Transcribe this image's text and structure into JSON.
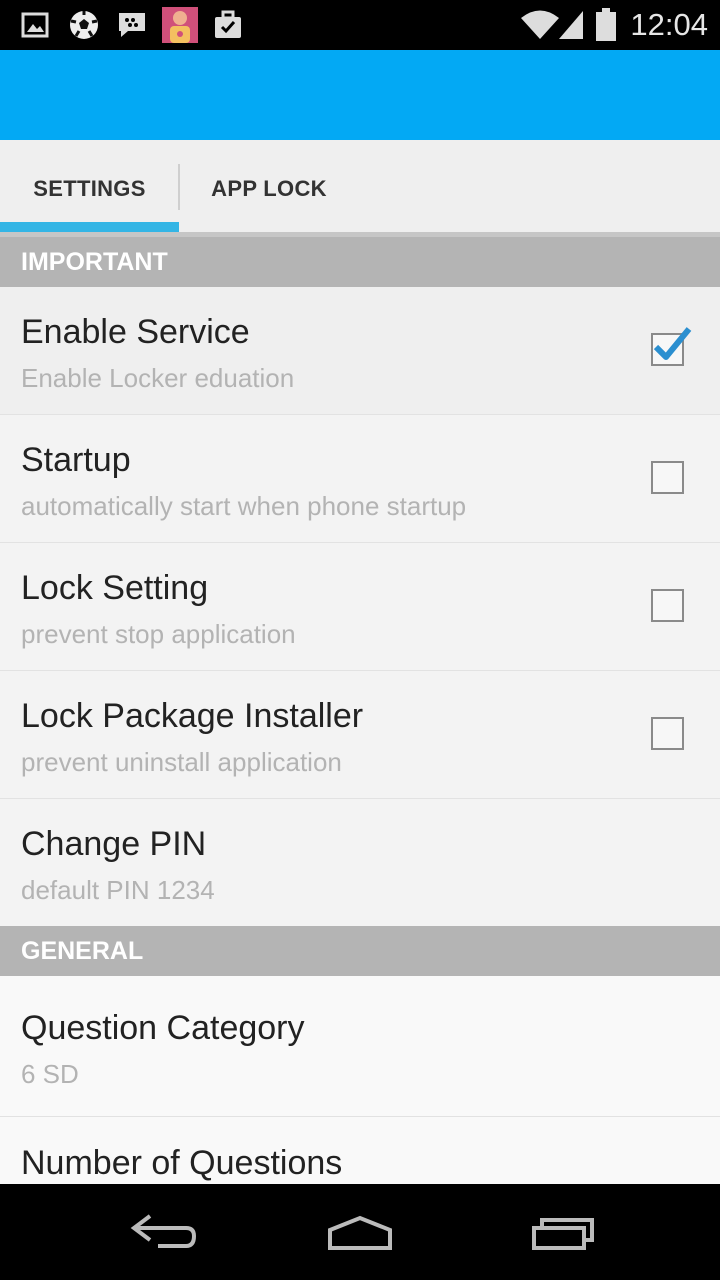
{
  "status_bar": {
    "time": "12:04",
    "left_icons": [
      "image-icon",
      "soccer-ball-icon",
      "bbm-chat-icon",
      "app-avatar-icon",
      "briefcase-check-icon"
    ],
    "right_icons": [
      "wifi-icon",
      "signal-icon",
      "battery-icon"
    ]
  },
  "tabs": [
    {
      "label": "SETTINGS",
      "selected": true
    },
    {
      "label": "APP LOCK",
      "selected": false
    }
  ],
  "sections": {
    "important": {
      "header": "IMPORTANT",
      "items": [
        {
          "title": "Enable Service",
          "summary": "Enable Locker eduation",
          "checked": true
        },
        {
          "title": "Startup",
          "summary": "automatically start when phone startup",
          "checked": false
        },
        {
          "title": "Lock Setting",
          "summary": "prevent stop application",
          "checked": false
        },
        {
          "title": "Lock Package Installer",
          "summary": "prevent uninstall application",
          "checked": false
        },
        {
          "title": "Change PIN",
          "summary": "default PIN 1234"
        }
      ]
    },
    "general": {
      "header": "GENERAL",
      "items": [
        {
          "title": "Question Category",
          "summary": "6 SD"
        },
        {
          "title": "Number of Questions"
        }
      ]
    }
  },
  "nav_bar": {
    "buttons": [
      "back-icon",
      "home-icon",
      "recent-apps-icon"
    ]
  },
  "colors": {
    "action_bar": "#03a9f4",
    "tab_indicator": "#33b5e5",
    "section_header_bg": "#b4b4b4",
    "check_mark": "#2b8fd0"
  }
}
